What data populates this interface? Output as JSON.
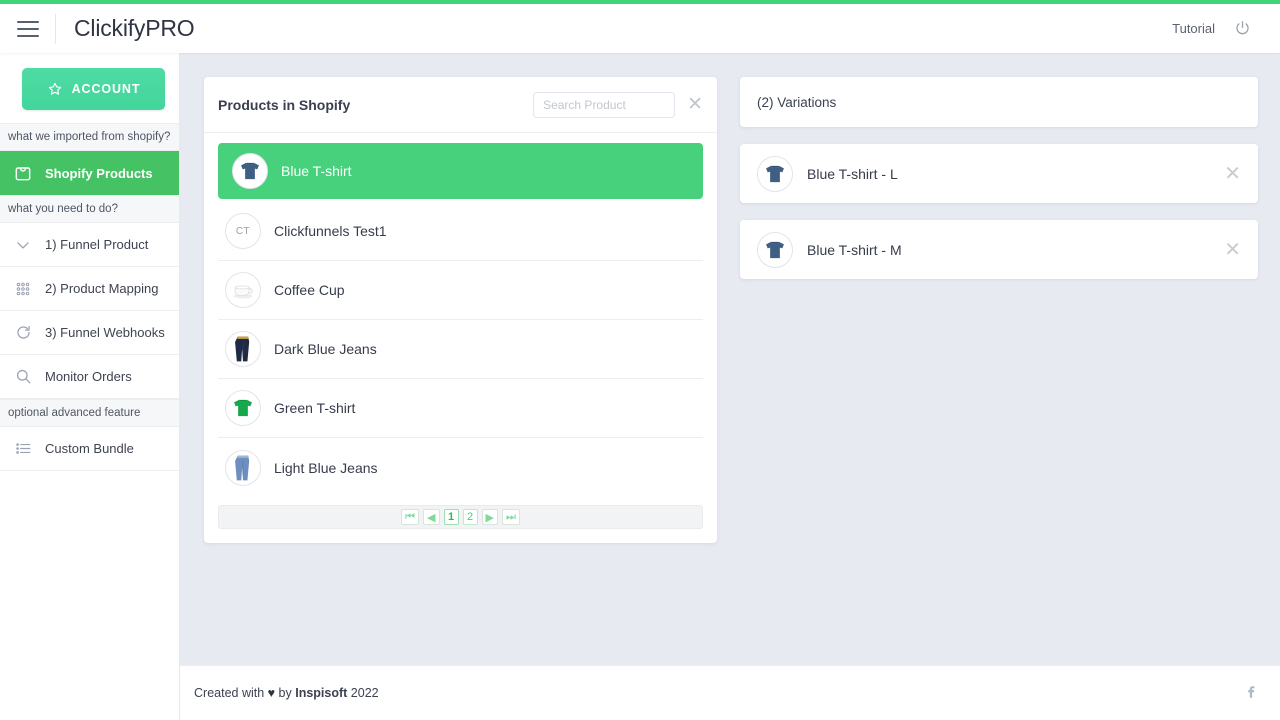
{
  "theme": {
    "accent_green": "#3fd679",
    "sidebar_active_green": "#45c364",
    "selected_row_green": "#48d17c",
    "account_button_green": "#45d69b",
    "page_background": "#e8eaf2"
  },
  "header": {
    "brand": "ClickifyPRO",
    "menu_icon": "hamburger-icon",
    "tutorial_label": "Tutorial",
    "power_icon": "power-icon"
  },
  "sidebar": {
    "account_button": {
      "label": "ACCOUNT",
      "icon": "star-icon"
    },
    "groups": [
      {
        "header": "what we imported from shopify?",
        "items": [
          {
            "label": "Shopify Products",
            "icon": "shopping-bag-icon",
            "active": true
          }
        ]
      },
      {
        "header": "what you need to do?",
        "items": [
          {
            "label": "1) Funnel Product",
            "icon": "chevron-down-icon",
            "active": false
          },
          {
            "label": "2) Product Mapping",
            "icon": "grid-dots-icon",
            "active": false
          },
          {
            "label": "3) Funnel Webhooks",
            "icon": "refresh-icon",
            "active": false
          },
          {
            "label": "Monitor Orders",
            "icon": "search-icon",
            "active": false
          }
        ]
      },
      {
        "header": "optional advanced feature",
        "items": [
          {
            "label": "Custom Bundle",
            "icon": "list-icon",
            "active": false
          }
        ]
      }
    ]
  },
  "products_panel": {
    "title": "Products in Shopify",
    "search_placeholder": "Search Product",
    "search_value": "",
    "clear_icon": "close-icon",
    "items": [
      {
        "name": "Blue T-shirt",
        "thumb": "blue-tshirt",
        "selected": true
      },
      {
        "name": "Clickfunnels Test1",
        "thumb": "initials",
        "initials": "CT",
        "selected": false
      },
      {
        "name": "Coffee Cup",
        "thumb": "coffee-cup",
        "selected": false
      },
      {
        "name": "Dark Blue Jeans",
        "thumb": "dark-jeans",
        "selected": false
      },
      {
        "name": "Green T-shirt",
        "thumb": "green-tshirt",
        "selected": false
      },
      {
        "name": "Light Blue Jeans",
        "thumb": "light-jeans",
        "selected": false
      }
    ],
    "pagination": {
      "first": "⏮",
      "prev": "◀",
      "pages": [
        "1",
        "2"
      ],
      "current_page": "1",
      "next": "▶",
      "last": "⏭"
    }
  },
  "variations_panel": {
    "title": "(2) Variations",
    "items": [
      {
        "name": "Blue T-shirt - L",
        "thumb": "blue-tshirt",
        "remove_icon": "close-icon"
      },
      {
        "name": "Blue T-shirt - M",
        "thumb": "blue-tshirt",
        "remove_icon": "close-icon"
      }
    ]
  },
  "footer": {
    "prefix": "Created with ",
    "heart": "♥",
    "middle": " by ",
    "company": "Inspisoft",
    "year": " 2022",
    "social_icon": "facebook-icon"
  }
}
